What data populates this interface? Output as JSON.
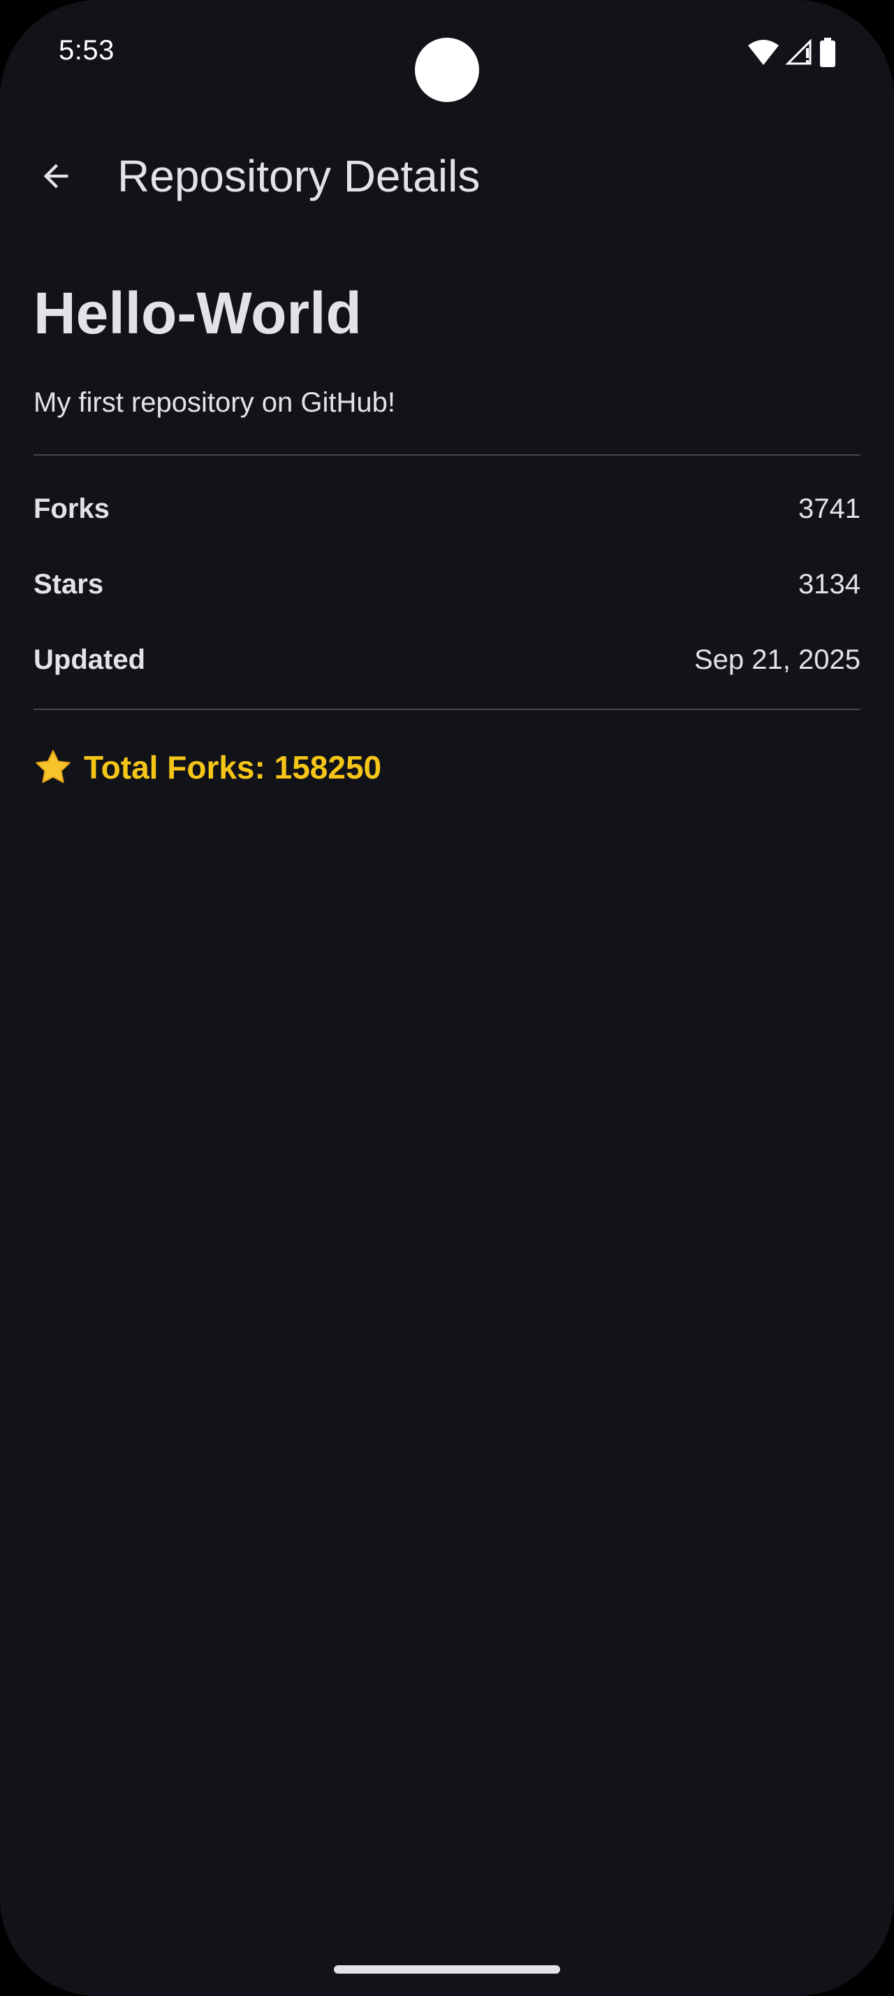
{
  "status_bar": {
    "time": "5:53",
    "icons": [
      "wifi-icon",
      "signal-icon",
      "battery-icon"
    ]
  },
  "app_bar": {
    "back_icon": "arrow-back-icon",
    "title": "Repository Details"
  },
  "repository": {
    "name": "Hello-World",
    "description": "My first repository on GitHub!",
    "stats": [
      {
        "label": "Forks",
        "value": "3741"
      },
      {
        "label": "Stars",
        "value": "3134"
      },
      {
        "label": "Updated",
        "value": "Sep 21, 2025"
      }
    ],
    "total_icon": "star-icon",
    "total_text": "Total Forks: 158250"
  },
  "colors": {
    "background": "#121318",
    "text": "#E4E2E9",
    "accent": "#F5C518",
    "divider": "#45464F"
  }
}
